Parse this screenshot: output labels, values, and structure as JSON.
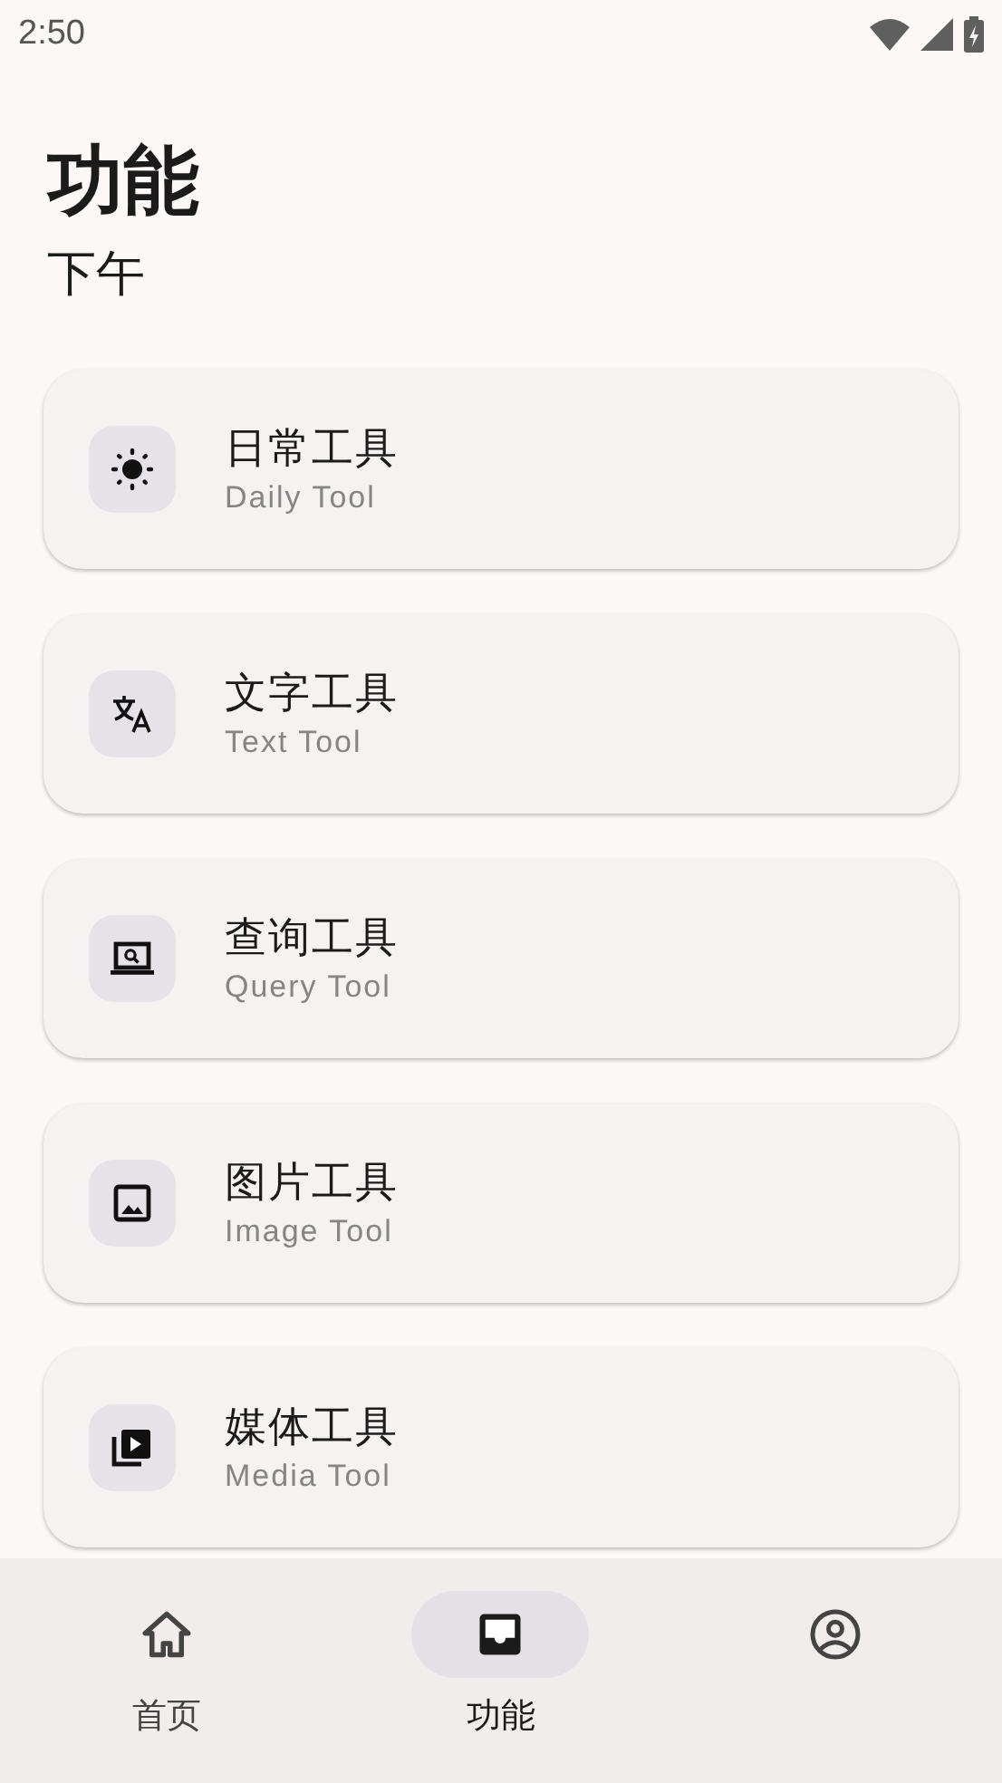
{
  "status_bar": {
    "time": "2:50"
  },
  "header": {
    "title": "功能",
    "subtitle": "下午"
  },
  "tools": [
    {
      "title": "日常工具",
      "subtitle": "Daily Tool"
    },
    {
      "title": "文字工具",
      "subtitle": "Text Tool"
    },
    {
      "title": "查询工具",
      "subtitle": "Query Tool"
    },
    {
      "title": "图片工具",
      "subtitle": "Image Tool"
    },
    {
      "title": "媒体工具",
      "subtitle": "Media Tool"
    }
  ],
  "bottom_nav": [
    {
      "label": "首页",
      "selected": false
    },
    {
      "label": "功能",
      "selected": true
    },
    {
      "selected": false
    }
  ]
}
